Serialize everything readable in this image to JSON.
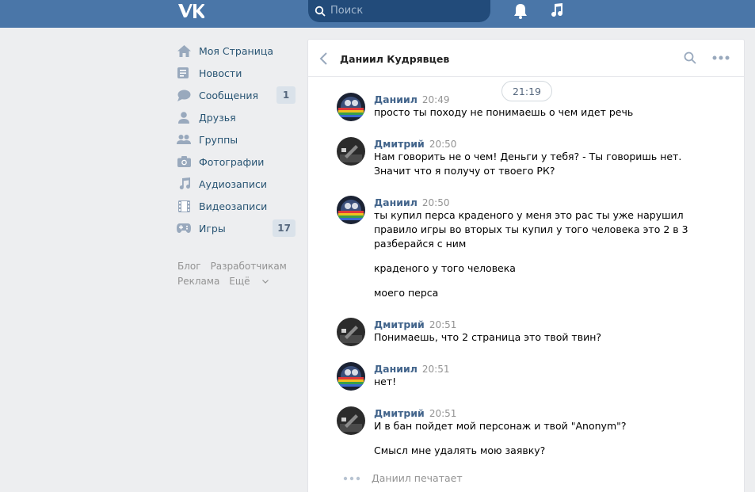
{
  "header": {
    "logo": "vk-logo",
    "search_placeholder": "Поиск"
  },
  "nav": {
    "items": [
      {
        "label": "Моя Страница",
        "icon": "home-icon"
      },
      {
        "label": "Новости",
        "icon": "news-icon"
      },
      {
        "label": "Сообщения",
        "icon": "messages-icon",
        "badge": "1"
      },
      {
        "label": "Друзья",
        "icon": "friends-icon"
      },
      {
        "label": "Группы",
        "icon": "groups-icon"
      },
      {
        "label": "Фотографии",
        "icon": "camera-icon"
      },
      {
        "label": "Аудиозаписи",
        "icon": "music-icon"
      },
      {
        "label": "Видеозаписи",
        "icon": "video-icon"
      },
      {
        "label": "Игры",
        "icon": "gamepad-icon",
        "badge": "17"
      }
    ],
    "footer": [
      "Блог",
      "Разработчикам",
      "Реклама",
      "Ещё"
    ]
  },
  "chat": {
    "title": "Даниил Кудрявцев",
    "date": "21:19",
    "messages": [
      {
        "author": "Даниил",
        "time": "20:49",
        "lines": [
          "просто ты походу не понимаешь о чем идет речь"
        ]
      },
      {
        "author": "Дмитрий",
        "time": "20:50",
        "lines": [
          "Нам говорить не о чем! Деньги у тебя? - Ты говоришь нет.",
          "Значит что я получу от твоего РК?"
        ]
      },
      {
        "author": "Даниил",
        "time": "20:50",
        "lines": [
          "ты купил перса краденого у меня это рас ты уже нарушил",
          "правило игры во вторых ты купил у того человека это 2 в 3",
          "разберайся с ним",
          "краденого у того человека",
          "моего перса"
        ]
      },
      {
        "author": "Дмитрий",
        "time": "20:51",
        "lines": [
          "Понимаешь, что 2 страница это твой твин?"
        ]
      },
      {
        "author": "Даниил",
        "time": "20:51",
        "lines": [
          "нет!"
        ]
      },
      {
        "author": "Дмитрий",
        "time": "20:51",
        "lines": [
          "И в бан пойдет мой персонаж и твой \"Anonym\"?",
          "Смысл мне удалять мою заявку?"
        ]
      }
    ],
    "typing": "Даниил печатает"
  },
  "colors": {
    "header_bg": "#4a76a8",
    "link": "#42648b",
    "page_bg": "#edeef0"
  }
}
